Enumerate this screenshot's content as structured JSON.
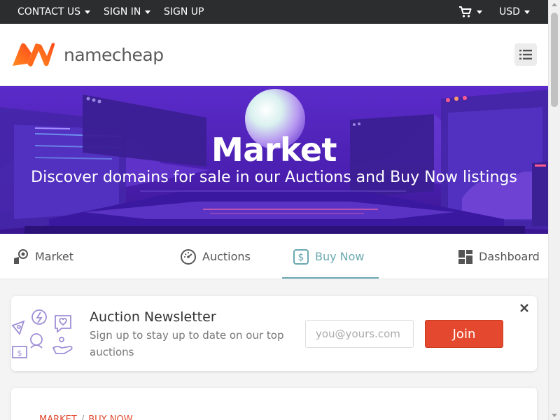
{
  "topbar": {
    "contact_label": "CONTACT US",
    "signin_label": "SIGN IN",
    "signup_label": "SIGN UP",
    "cart_icon": "cart-icon",
    "currency_label": "USD"
  },
  "header": {
    "logo_text": "namecheap",
    "menu_icon": "menu-list-icon"
  },
  "hero": {
    "title": "Market",
    "subtitle": "Discover domains for sale in our Auctions and Buy Now listings"
  },
  "tabs": [
    {
      "label": "Market",
      "icon": "market-icon"
    },
    {
      "label": "Auctions",
      "icon": "gauge-icon"
    },
    {
      "label": "Buy Now",
      "icon": "dollar-icon"
    },
    {
      "label": "Dashboard",
      "icon": "dashboard-icon"
    }
  ],
  "active_tab": "Buy Now",
  "newsletter": {
    "title": "Auction Newsletter",
    "description": "Sign up to stay up to date on our top auctions",
    "email_placeholder": "you@yours.com",
    "join_label": "Join"
  },
  "breadcrumb": {
    "items": [
      "MARKET",
      "BUY NOW"
    ],
    "separator": "/"
  },
  "colors": {
    "topbar": "#2b2d2f",
    "brand_orange": "#ff5f1f",
    "hero_purple": "#5b2bc9",
    "active_tab": "#6aa8b1",
    "join_button": "#e4492f"
  }
}
